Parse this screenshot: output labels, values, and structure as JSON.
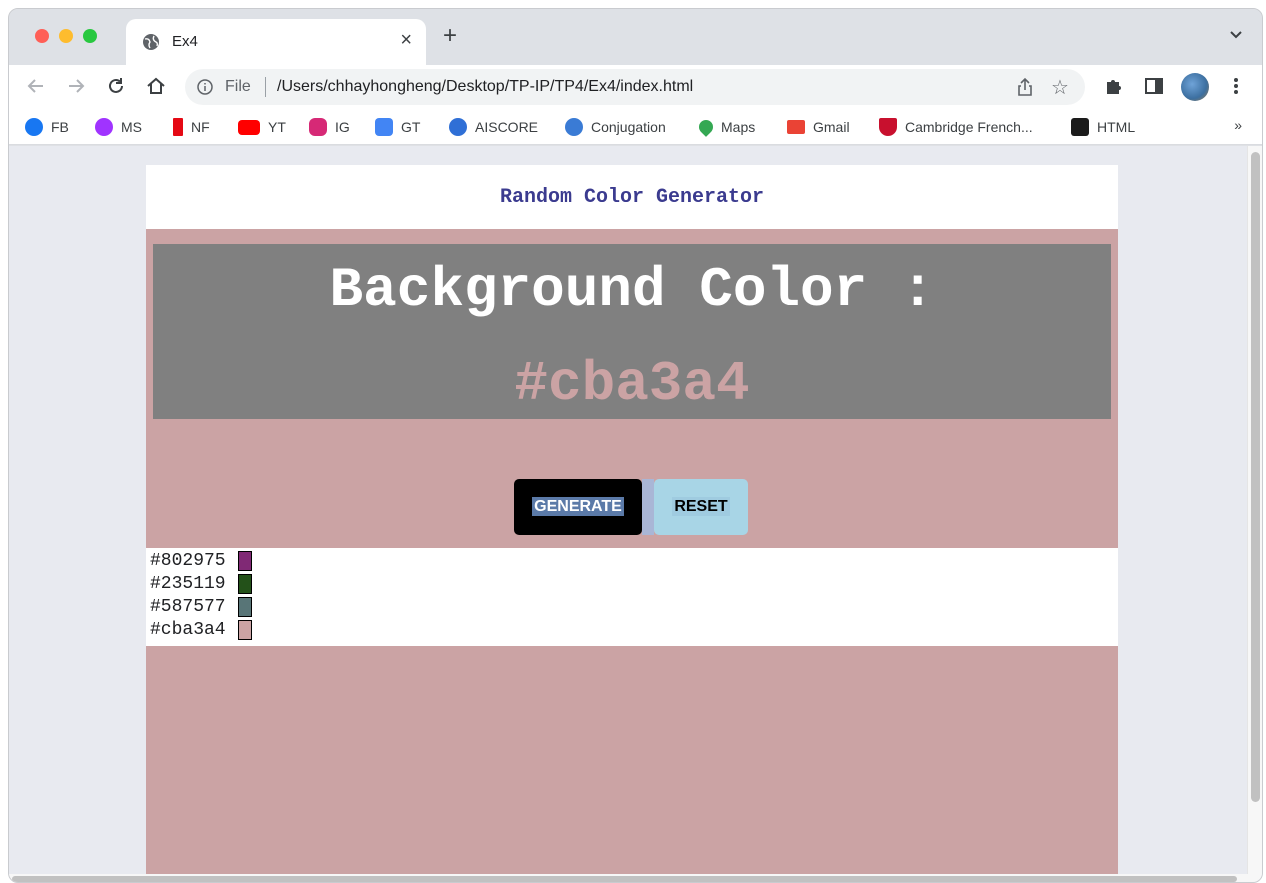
{
  "browser": {
    "tab_title": "Ex4",
    "tab_close": "×",
    "new_tab": "+",
    "address_label": "File",
    "url": "/Users/chhayhongheng/Desktop/TP-IP/TP4/Ex4/index.html",
    "star": "☆",
    "bookmarks": [
      {
        "label": "FB",
        "icon": "facebook-icon",
        "color": "#1877f2"
      },
      {
        "label": "MS",
        "icon": "messenger-icon",
        "color": "#a033ff"
      },
      {
        "label": "NF",
        "icon": "netflix-icon",
        "color": "#e50914"
      },
      {
        "label": "YT",
        "icon": "youtube-icon",
        "color": "#ff0000"
      },
      {
        "label": "IG",
        "icon": "instagram-icon",
        "color": "#d62976"
      },
      {
        "label": "GT",
        "icon": "google-translate-icon",
        "color": "#4285f4"
      },
      {
        "label": "AISCORE",
        "icon": "aiscore-icon",
        "color": "#2f6fd6"
      },
      {
        "label": "Conjugation",
        "icon": "conjugation-icon",
        "color": "#3a7bd5"
      },
      {
        "label": "Maps",
        "icon": "maps-icon",
        "color": "#34a853"
      },
      {
        "label": "Gmail",
        "icon": "gmail-icon",
        "color": "#ea4335"
      },
      {
        "label": "Cambridge French...",
        "icon": "cambridge-icon",
        "color": "#c8102e"
      },
      {
        "label": "HTML",
        "icon": "html-icon",
        "color": "#1b1b1b"
      }
    ],
    "bookmarks_more": "»"
  },
  "page": {
    "title": "Random Color Generator",
    "display_label": "Background Color :",
    "display_value": "#cba3a4",
    "background_color": "#cba3a4",
    "generate_label": "GENERATE",
    "reset_label": "RESET",
    "history": [
      {
        "hex": "#802975",
        "color": "#802975"
      },
      {
        "hex": "#235119",
        "color": "#235119"
      },
      {
        "hex": "#587577",
        "color": "#587577"
      },
      {
        "hex": "#cba3a4",
        "color": "#cba3a4"
      }
    ]
  }
}
